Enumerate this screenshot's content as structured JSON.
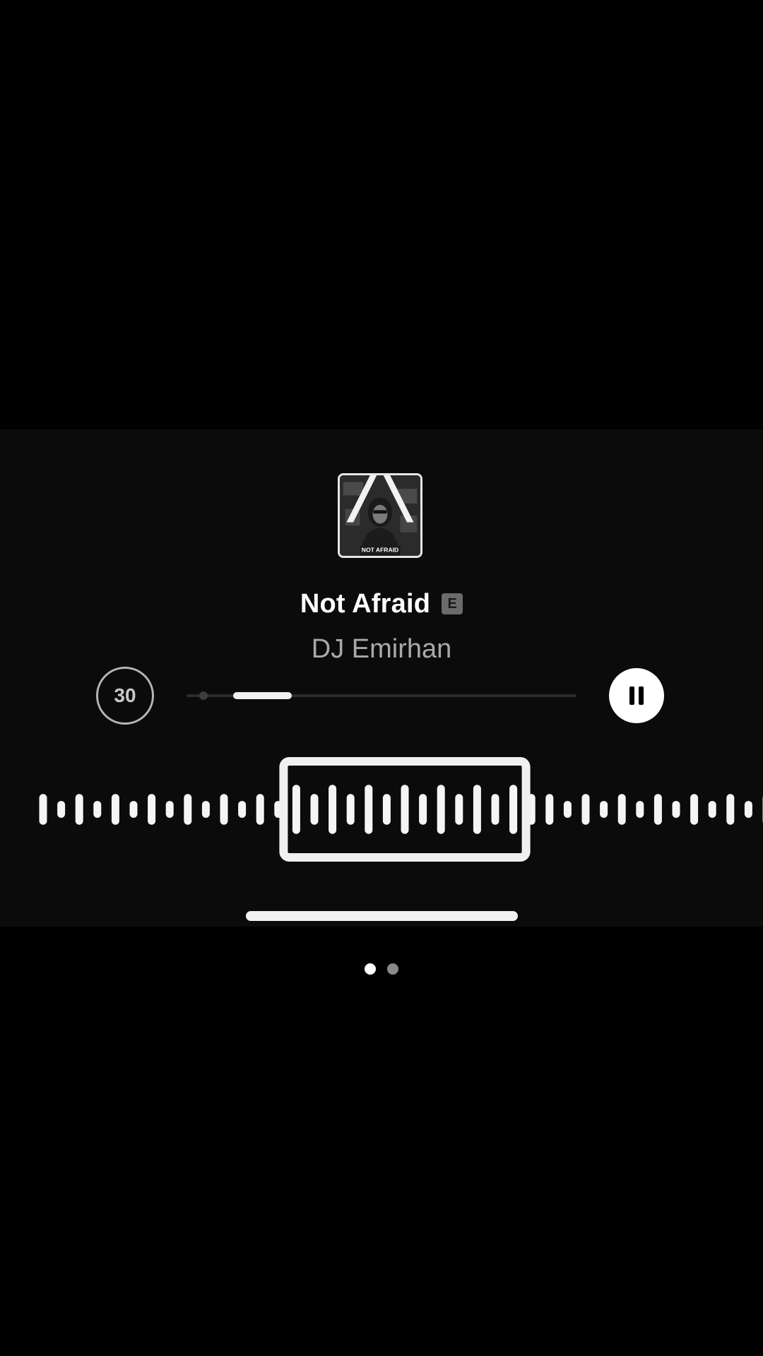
{
  "track": {
    "title": "Not Afraid",
    "explicit_label": "E",
    "artist": "DJ Emirhan",
    "album_art_caption": "NOT AFRAID"
  },
  "controls": {
    "skip_label": "30",
    "pause_icon": "pause-icon",
    "skip_icon": "skip-30-icon"
  },
  "progress": {
    "played_fraction": 0.03,
    "selection_start_fraction": 0.12,
    "selection_end_fraction": 0.27
  },
  "waveform": {
    "bar_heights": [
      1,
      0.55,
      1,
      0.55,
      1,
      0.55,
      1,
      0.55,
      1,
      0.55,
      1,
      0.55,
      1,
      0.55,
      1.6,
      1,
      1.6,
      1,
      1.6,
      1,
      1.6,
      1,
      1.6,
      1,
      1.6,
      1,
      1.6,
      1,
      1,
      0.55,
      1,
      0.55,
      1,
      0.55,
      1,
      0.55,
      1,
      0.55,
      1,
      0.55,
      1,
      0.55,
      1
    ],
    "selected_range": [
      14,
      27
    ]
  },
  "pager": {
    "count": 2,
    "active": 0
  },
  "colors": {
    "background": "#000000",
    "panel": "#0b0b0b",
    "accent": "#ffffff",
    "muted": "#a9a9a9",
    "inactive_dot": "#8a8a8a"
  }
}
